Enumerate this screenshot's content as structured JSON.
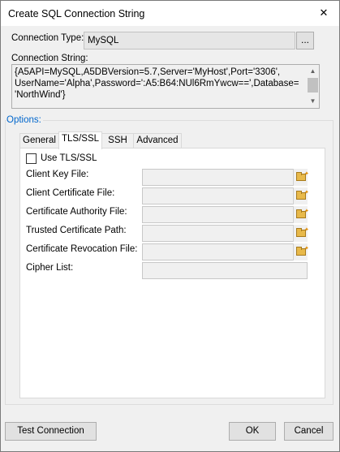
{
  "window": {
    "title": "Create SQL Connection String",
    "close_glyph": "✕"
  },
  "connection_type": {
    "label": "Connection Type:",
    "value": "MySQL",
    "browse_label": "..."
  },
  "connection_string": {
    "label": "Connection String:",
    "value": "{A5API=MySQL,A5DBVersion=5.7,Server='MyHost',Port='3306',\nUserName='Alpha',Password=':A5:B64:NUl6RmYwcw==',Database=\n'NorthWind'}"
  },
  "options": {
    "label": "Options:",
    "tabs": [
      {
        "label": "General",
        "active": false
      },
      {
        "label": "TLS/SSL",
        "active": true
      },
      {
        "label": "SSH",
        "active": false
      },
      {
        "label": "Advanced",
        "active": false
      }
    ],
    "use_tls": {
      "label": "Use TLS/SSL",
      "checked": false
    },
    "fields": [
      {
        "label": "Client Key File:",
        "value": ""
      },
      {
        "label": "Client Certificate File:",
        "value": ""
      },
      {
        "label": "Certificate Authority File:",
        "value": ""
      },
      {
        "label": "Trusted Certificate Path:",
        "value": ""
      },
      {
        "label": "Certificate Revocation File:",
        "value": ""
      },
      {
        "label": "Cipher List:",
        "value": ""
      }
    ]
  },
  "buttons": {
    "test_connection": "Test Connection",
    "ok": "OK",
    "cancel": "Cancel"
  },
  "icons": {
    "folder": "folder-open-icon"
  }
}
